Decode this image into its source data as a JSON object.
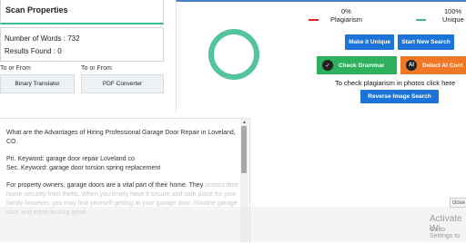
{
  "scan_properties": {
    "title": "Scan Properties",
    "word_count_label": "Number of Words : 732",
    "results_found_label": "Results Found : 0"
  },
  "converters": {
    "left_label": "To or From",
    "right_label": "To or From",
    "binary_button": "Binary Translator",
    "pdf_button": "PDF Converter"
  },
  "result": {
    "min_percent": "0%",
    "max_percent": "100%",
    "legend_plagiarism": "Plagiarism",
    "legend_unique": "Unique",
    "plagiarism_color": "#e02424",
    "unique_color": "#3dbb8e",
    "make_unique_button": "Make it Unique",
    "new_search_button": "Start New Search",
    "check_grammar_button": "Check Grammar",
    "detect_ai_button": "Detect AI Cont",
    "photo_check_text": "To check plagiarism in photos click here",
    "reverse_image_button": "Reverse Image Search"
  },
  "editor": {
    "para1": "What are the Advantages of Hiring Professional Garage Door Repair in Loveland, CO.",
    "para2_line1": "Pri. Keyword: garage door repair Loveland co",
    "para2_line2": "Sec. Keyword: garage door torsion spring replacement",
    "para3_visible": "For property owners, garage doors are a vital part of their home. They",
    "para3_faded": "protect their home security from thefts. When you timely have it secure and safe place for your family however, you may find yourself getting at your garage door. Routine garage door and experiencing good"
  },
  "overlay": {
    "close_label": "close",
    "activate_title": "Activate Wi",
    "activate_sub": "Go to Settings to"
  }
}
